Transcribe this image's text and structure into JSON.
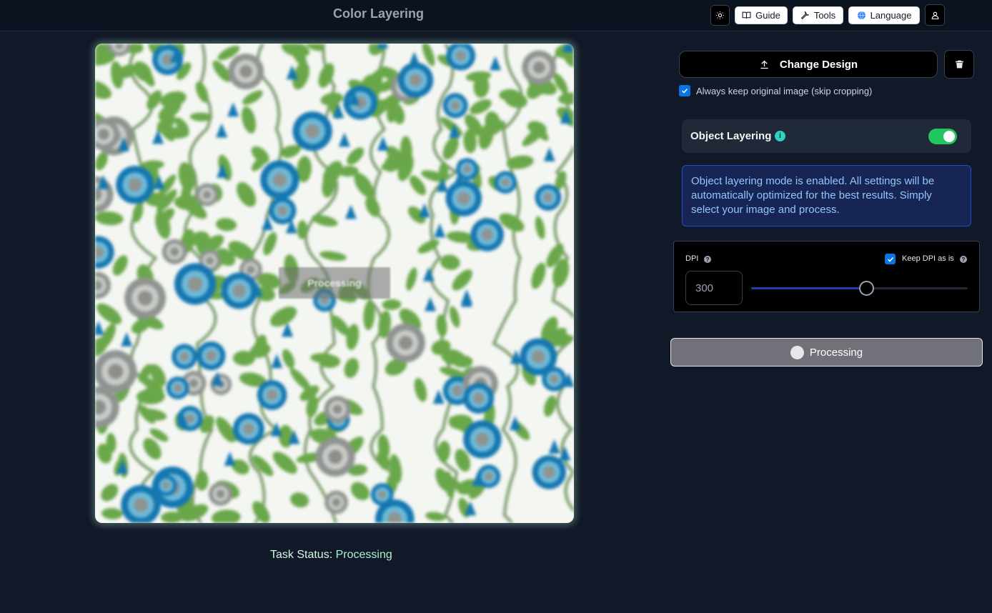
{
  "header": {
    "title": "Color Layering",
    "guide_label": "Guide",
    "tools_label": "Tools",
    "language_label": "Language"
  },
  "preview": {
    "overlay_text": "Processing",
    "status_label": "Task Status:",
    "status_value": "Processing"
  },
  "controls": {
    "change_design_label": "Change Design",
    "keep_original_label": "Always keep original image (skip cropping)",
    "keep_original_checked": true,
    "object_layering_label": "Object Layering",
    "object_layering_enabled": true,
    "info_text": "Object layering mode is enabled. All settings will be automatically optimized for the best results. Simply select your image and process.",
    "dpi_label": "DPI",
    "keep_dpi_label": "Keep DPI as is",
    "keep_dpi_checked": true,
    "dpi_value": "300",
    "dpi_slider_fraction": 0.53,
    "process_label": "Processing"
  },
  "colors": {
    "accent_blue": "#0b74e5",
    "toggle_on": "#22c55e",
    "info_text": "#93c5fd",
    "pattern_blue": "#1577b0",
    "pattern_green": "#6aa74a",
    "pattern_gray": "#8f9490"
  }
}
